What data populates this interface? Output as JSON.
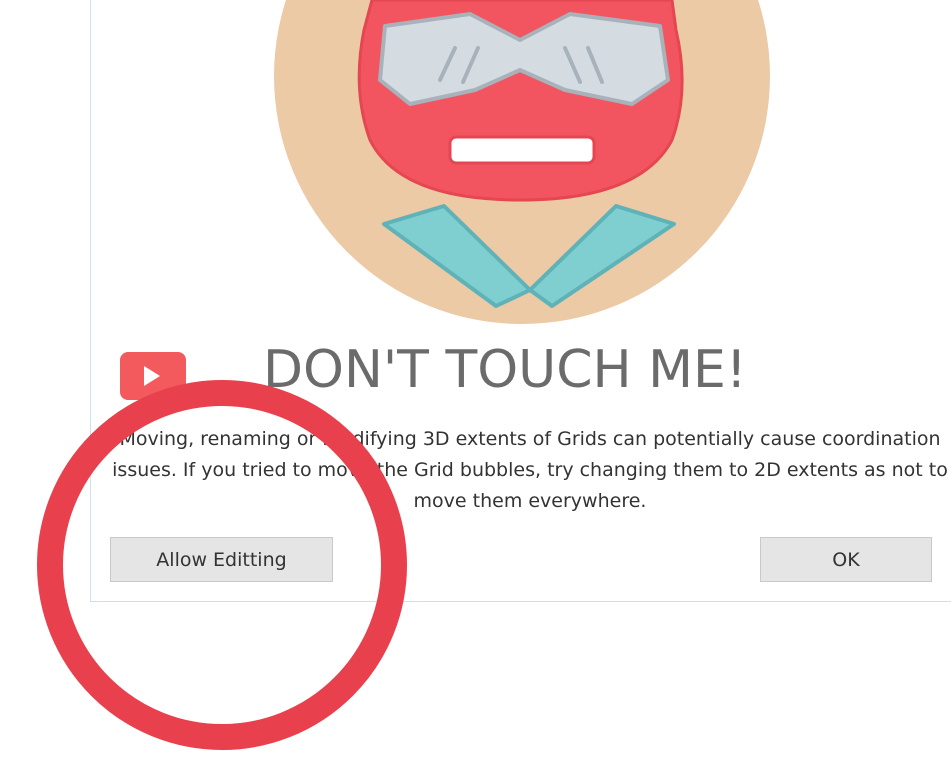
{
  "dialog": {
    "title": "DON'T TOUCH ME!",
    "message": "Moving, renaming or modifying 3D extents of Grids can potentially cause coordination issues. If you tried to move the Grid bubbles, try changing them to 2D extents as not to move them everywhere.",
    "allow_label": "Allow Editting",
    "ok_label": "OK"
  },
  "colors": {
    "accent_red": "#f25a5e",
    "skin": "#ebcaa5",
    "visor": "#d5dce1",
    "collar": "#7fcfd0",
    "annotation_circle": "#e8404c"
  },
  "icons": {
    "title_badge": "play-badge-icon",
    "mascot": "robot-mascot-illustration"
  }
}
